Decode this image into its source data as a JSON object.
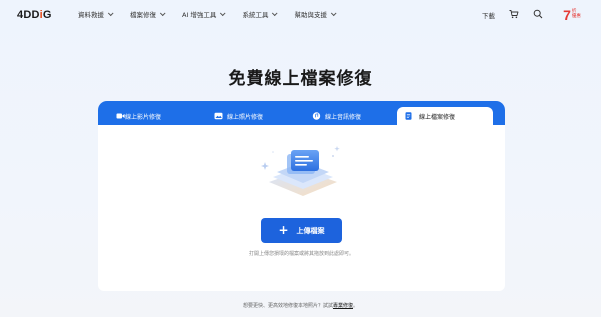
{
  "header": {
    "logo": {
      "num": "4D",
      "d": "D",
      "i": "i",
      "g": "G"
    },
    "nav": [
      "資料救援",
      "檔案修復",
      "AI 增強工具",
      "系統工具",
      "幫助與支援"
    ],
    "download": "下載",
    "icons": {
      "cart": "cart-icon",
      "search": "search-icon"
    },
    "promo": {
      "number": "7",
      "line1": "折",
      "line2": "優惠"
    }
  },
  "main": {
    "title": "免費線上檔案修復",
    "tabs": [
      {
        "label": "線上影片修復",
        "icon": "video-icon"
      },
      {
        "label": "線上照片修復",
        "icon": "photo-icon"
      },
      {
        "label": "線上音訊修復",
        "icon": "audio-icon"
      },
      {
        "label": "線上檔案修復",
        "icon": "file-icon"
      }
    ],
    "active_tab": 3,
    "upload_label": "上傳檔案",
    "hint": "打開上傳您損壞的檔案或將其拖放到此處即可。"
  },
  "footer": {
    "text": "想要更快、更高效地修復本地照片？試試",
    "link": "專業修復",
    "end": "。"
  },
  "colors": {
    "accent": "#1e6fe8",
    "button": "#1d63dd",
    "logo_i": "#e64a19",
    "promo": "#e53935"
  }
}
